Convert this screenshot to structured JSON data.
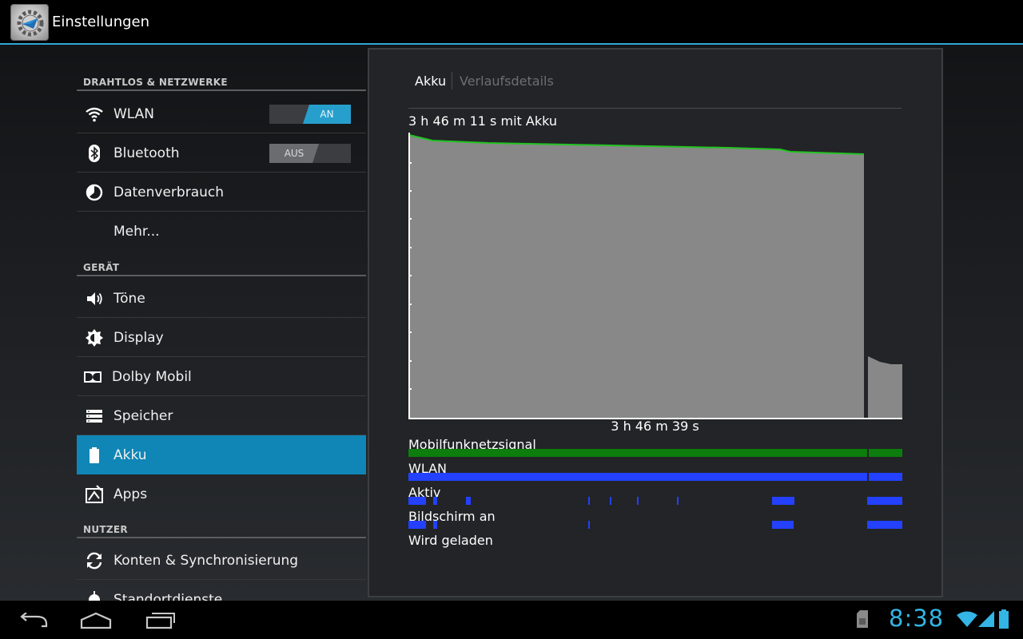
{
  "app": {
    "title": "Einstellungen"
  },
  "nav": {
    "sections": [
      {
        "header": "DRAHTLOS & NETZWERKE"
      },
      {
        "header": "GERÄT"
      },
      {
        "header": "NUTZER"
      }
    ],
    "items": [
      {
        "label": "WLAN",
        "icon": "wifi-icon",
        "toggle": "AN"
      },
      {
        "label": "Bluetooth",
        "icon": "bluetooth-icon",
        "toggle": "AUS"
      },
      {
        "label": "Datenverbrauch",
        "icon": "data-usage-icon"
      },
      {
        "label": "Mehr..."
      },
      {
        "label": "Töne",
        "icon": "speaker-icon"
      },
      {
        "label": "Display",
        "icon": "brightness-icon"
      },
      {
        "label": "Dolby Mobil",
        "icon": "dolby-icon"
      },
      {
        "label": "Speicher",
        "icon": "storage-icon"
      },
      {
        "label": "Akku",
        "icon": "battery-icon",
        "selected": true
      },
      {
        "label": "Apps",
        "icon": "apps-icon"
      },
      {
        "label": "Konten & Synchronisierung",
        "icon": "sync-icon"
      },
      {
        "label": "Standortdienste",
        "icon": "location-icon"
      }
    ]
  },
  "battery": {
    "tabs": {
      "active": "Akku",
      "inactive": "Verlaufsdetails"
    },
    "on_battery": "3 h 46 m 11 s mit Akku",
    "elapsed": "3 h 46 m 39 s",
    "tracks": [
      {
        "label": "Mobilfunknetzsignal",
        "color": "#0d7d0d"
      },
      {
        "label": "WLAN",
        "color": "#2341ff"
      },
      {
        "label": "Aktiv",
        "color": "#2341ff"
      },
      {
        "label": "Bildschirm an",
        "color": "#2341ff"
      },
      {
        "label": "Wird geladen",
        "color": "#2341ff"
      }
    ],
    "colors": {
      "fill": "#888888",
      "line": "#22c422",
      "accent": "#33b5e5",
      "selected": "#0f86b6"
    }
  },
  "status_bar": {
    "time": "8:38"
  }
}
